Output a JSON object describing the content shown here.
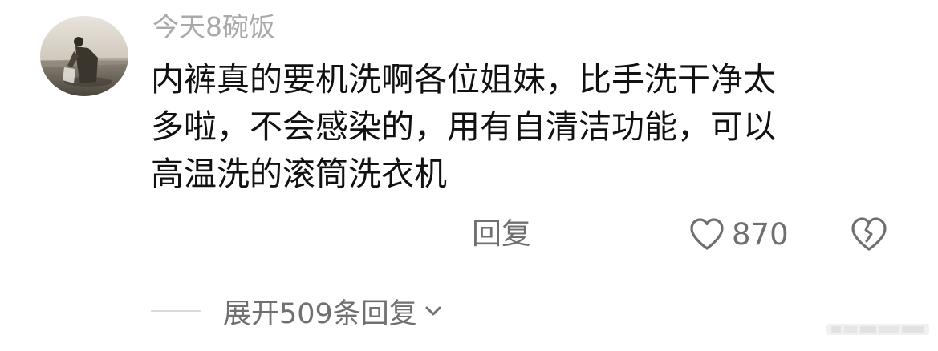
{
  "comment": {
    "username": "今天8碗饭",
    "text_lines": [
      "内裤真的要机洗啊各位姐妹，比手洗干净太",
      "多啦，不会感染的，用有自清洁功能，可以",
      "高温洗的滚筒洗衣机"
    ],
    "avatar_icon": "user-avatar-photo"
  },
  "actions": {
    "reply_label": "回复",
    "like_icon": "heart-outline-icon",
    "like_count": "870",
    "dislike_icon": "broken-heart-icon"
  },
  "replies": {
    "expand_label": "展开509条回复",
    "expand_icon": "chevron-down-icon"
  },
  "colors": {
    "username": "#a9a9a9",
    "text": "#111111",
    "secondary": "#6f6f6f",
    "divider": "#dadada"
  }
}
